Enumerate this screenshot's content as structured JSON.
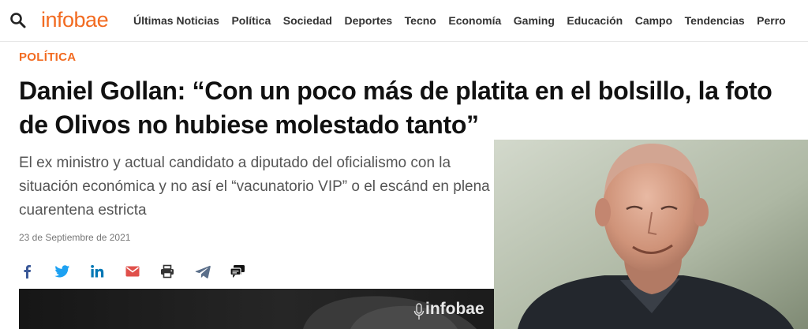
{
  "header": {
    "logo": "infobae",
    "nav": [
      "Últimas Noticias",
      "Política",
      "Sociedad",
      "Deportes",
      "Tecno",
      "Economía",
      "Gaming",
      "Educación",
      "Campo",
      "Tendencias",
      "Perro"
    ]
  },
  "article": {
    "section": "POLÍTICA",
    "headline": "Daniel Gollan: “Con un poco más de platita en el bolsillo, la foto de Olivos no hubiese molestado tanto”",
    "dek": "El ex ministro y actual candidato a diputado del oficialismo con la situación económica y no así el “vacunatorio VIP” o el escánd en plena cuarentena estricta",
    "date": "23 de Septiembre de 2021",
    "lead_image_watermark": "infobae"
  },
  "share": [
    "facebook-icon",
    "twitter-icon",
    "linkedin-icon",
    "email-icon",
    "print-icon",
    "telegram-icon",
    "comments-icon"
  ],
  "colors": {
    "brand": "#f26b21",
    "headline": "#111111",
    "facebook": "#3b5998",
    "twitter": "#1da1f2",
    "linkedin": "#0077b5",
    "email": "#e0504b",
    "telegram": "#2ca5e0"
  }
}
